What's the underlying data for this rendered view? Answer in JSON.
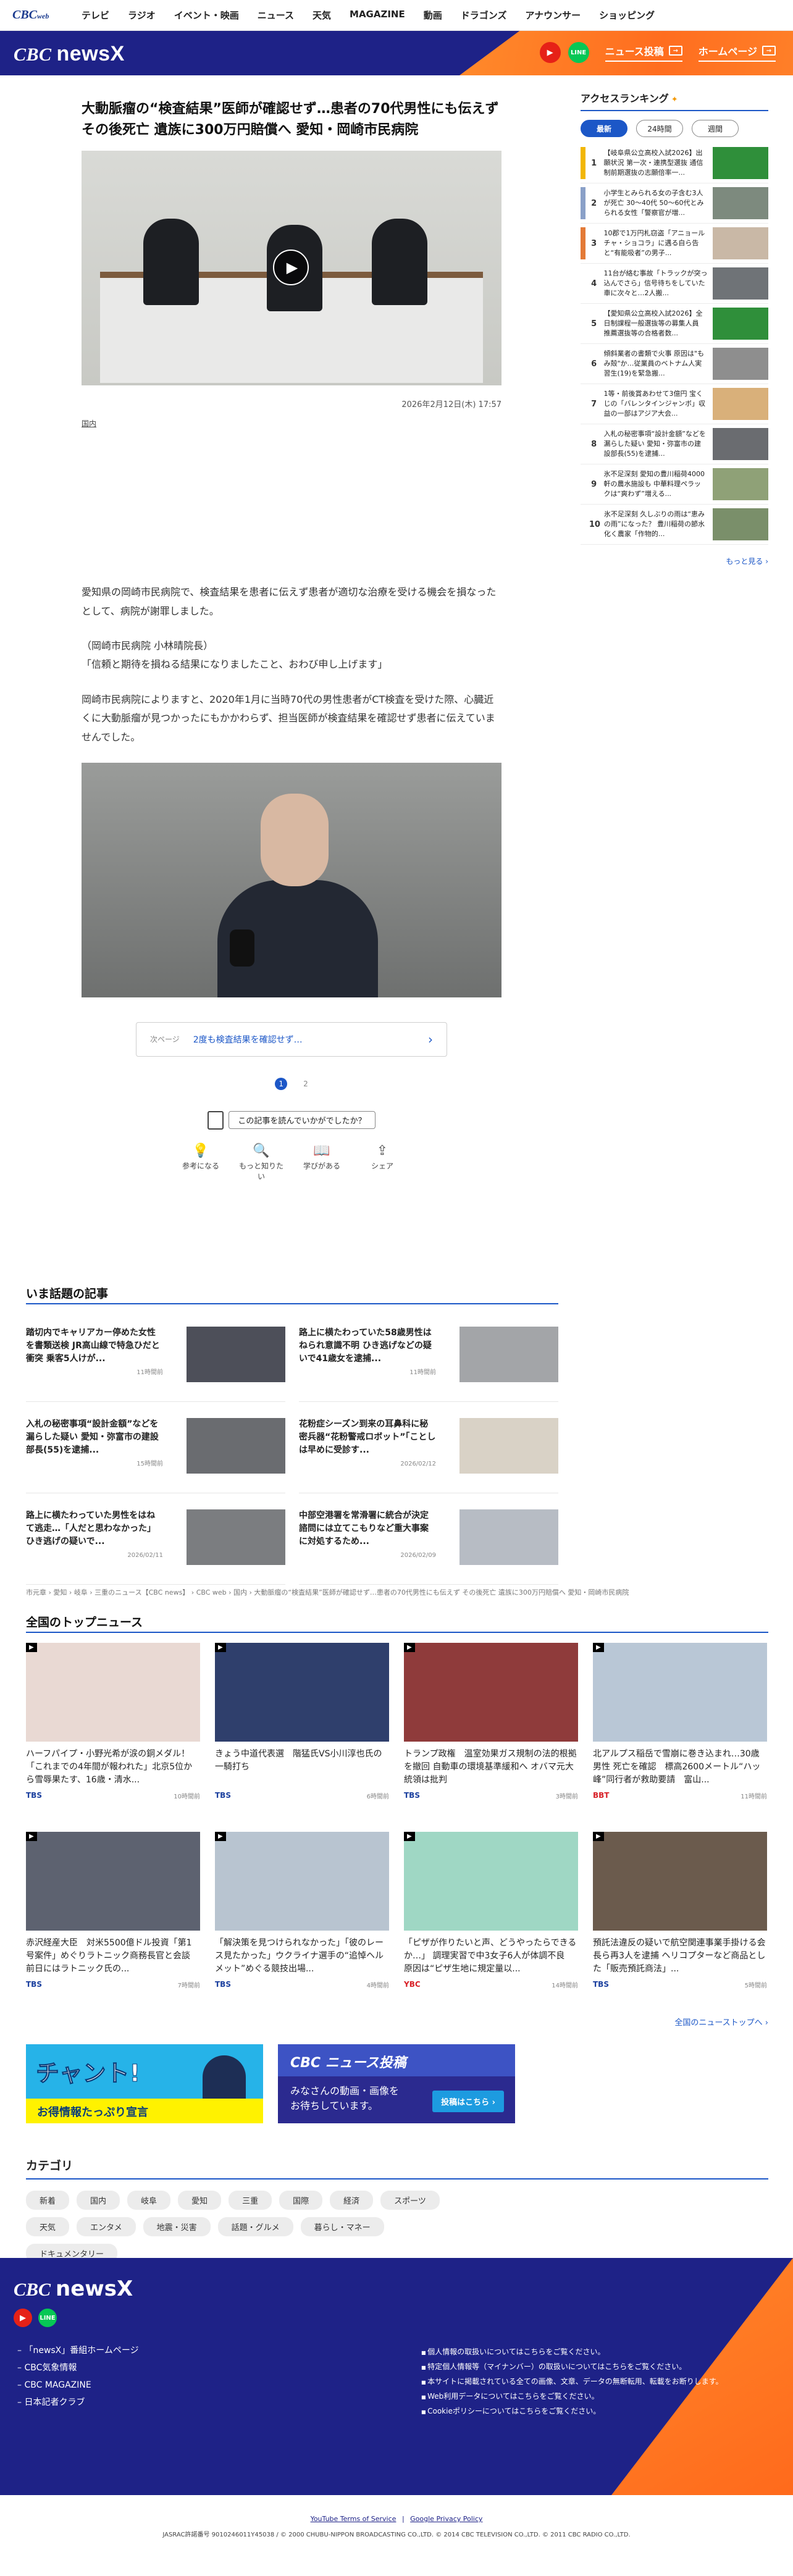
{
  "topbar": {
    "logo": "CBC",
    "logo_sub": "web",
    "nav": [
      "テレビ",
      "ラジオ",
      "イベント・映画",
      "ニュース",
      "天気",
      "MAGAZINE",
      "動画",
      "ドラゴンズ",
      "アナウンサー",
      "ショッピング"
    ]
  },
  "brand": {
    "logo_cbc": "CBC",
    "logo_name": "newsX",
    "post_label": "ニュース投稿",
    "home_label": "ホームページ"
  },
  "article": {
    "headline": "大動脈瘤の“検査結果”医師が確認せず…患者の70代男性にも伝えず その後死亡 遺族に300万円賠償へ 愛知・岡崎市民病院",
    "date": "2026年2月12日(木) 17:57",
    "category": "国内",
    "paragraphs": [
      "愛知県の岡崎市民病院で、検査結果を患者に伝えず患者が適切な治療を受ける機会を損なったとして、病院が謝罪しました。",
      "（岡崎市民病院 小林晴院長）\n「信頼と期待を損ねる結果になりましたこと、おわび申し上げます」",
      "岡崎市民病院によりますと、2020年1月に当時70代の男性患者がCT検査を受けた際、心臓近くに大動脈瘤が見つかったにもかかわらず、担当医師が検査結果を確認せず患者に伝えていませんでした。"
    ],
    "next_label": "次ページ",
    "next_title": "2度も検査結果を確認せず…",
    "pages": [
      "1",
      "2"
    ],
    "feedback_q": "この記事を読んでいかがでしたか？",
    "feedback": [
      {
        "icon": "lightbulb-icon",
        "glyph": "💡",
        "label": "参考になる"
      },
      {
        "icon": "search-icon",
        "glyph": "🔍",
        "label": "もっと知りたい"
      },
      {
        "icon": "book-icon",
        "glyph": "📖",
        "label": "学びがある"
      },
      {
        "icon": "share-icon",
        "glyph": "⇪",
        "label": "シェア"
      }
    ]
  },
  "ranking": {
    "title": "アクセスランキング",
    "tabs": [
      "最新",
      "24時間",
      "週間"
    ],
    "items": [
      {
        "num": "1",
        "color": "#f2b705",
        "text": "【岐阜県公立高校入試2026】出願状況 第一次・連携型選抜 通信制前期選抜の志願倍率一...",
        "thumb": "#2f8f3a"
      },
      {
        "num": "2",
        "color": "#8aa0c8",
        "text": "小学生とみられる女の子含む3人が死亡 30〜40代 50〜60代とみられる女性「警察官が増...",
        "thumb": "#7d8a7e"
      },
      {
        "num": "3",
        "color": "#e37a37",
        "text": "10郡で1万円札窃盗「アニョールチャ・ショコラ」に遇る自ら告と“有能吸者”の男子...",
        "thumb": "#c9b8a6"
      },
      {
        "num": "4",
        "color": "",
        "text": "11台が絡む事故「トラックが突っ込んでさら」信号待ちをしていた車に次々と…2人搬...",
        "thumb": "#6f7377"
      },
      {
        "num": "5",
        "color": "",
        "text": "【愛知県公立高校入試2026】全日制課程一般選抜等の募集人員 推薦選抜等の合格者数...",
        "thumb": "#2f8f3a"
      },
      {
        "num": "6",
        "color": "",
        "text": "傾斜業者の書類で火事 原因は\"もみ殻\"か…従業員のベトナム人実習生(19)を緊急搬...",
        "thumb": "#8e8e8e"
      },
      {
        "num": "7",
        "color": "",
        "text": "1等・前後賞あわせて3億円 宝くじの「バレンタインジャンボ」収益の一部はアジア大会...",
        "thumb": "#d9b07a"
      },
      {
        "num": "8",
        "color": "",
        "text": "入札の秘密事項“設計金額”などを漏らした疑い 愛知・弥富市の建設部長(55)を逮捕...",
        "thumb": "#6a6c70"
      },
      {
        "num": "9",
        "color": "",
        "text": "氷不足深刻 愛知の豊川稲荷4000軒の農水施設も 中華料理ペラックは“爽わず”増える...",
        "thumb": "#8fa177"
      },
      {
        "num": "10",
        "color": "",
        "text": "氷不足深刻 久しぶりの雨は“恵みの雨”になった？ 豊川稲荷の節水化く農家「作物的...",
        "thumb": "#7a8f6a"
      }
    ],
    "more": "もっと見る ›"
  },
  "trending": {
    "title": "いま話題の記事",
    "items": [
      {
        "text": "踏切内でキャリアカー停めた女性を書類送検 JR高山線で特急ひだと衝突 乗客5人けが...",
        "date": "11時間前",
        "thumb": "#4d4f59"
      },
      {
        "text": "路上に横たわっていた58歳男性はねられ意識不明 ひき逃げなどの疑いで41歳女を逮捕...",
        "date": "11時間前",
        "thumb": "#a3a5a8"
      },
      {
        "text": "入札の秘密事項“設計金額”などを漏らした疑い 愛知・弥富市の建設部長(55)を逮捕...",
        "date": "15時間前",
        "thumb": "#6a6c70"
      },
      {
        "text": "花粉症シーズン到来の耳鼻科に秘密兵器“花粉警戒ロボット”「ことしは早めに受診す...",
        "date": "2026/02/12",
        "thumb": "#d9d2c6"
      },
      {
        "text": "路上に横たわっていた男性をはねて逃走…「人だと思わなかった」ひき逃げの疑いで...",
        "date": "2026/02/11",
        "thumb": "#7b7d80"
      },
      {
        "text": "中部空港署を常滑署に統合が決定 諮問には立てこもりなど重大事案に対処するため...",
        "date": "2026/02/09",
        "thumb": "#b7bcc4"
      }
    ]
  },
  "breadcrumb": "市元章 › 愛知 › 岐阜 › 三重のニュース【CBC news】 › CBC web › 国内 › 大動脈瘤の“検査結果”医師が確認せず…患者の70代男性にも伝えず その後死亡 遺族に300万円賠償へ 愛知・岡崎市民病院",
  "topnews": {
    "title": "全国のトップニュース",
    "items": [
      {
        "text": "ハーフパイプ・小野光希が涙の銅メダル！「これまでの4年間が報われた」北京5位から雪辱果たす、16歳・清水...",
        "src": "TBS",
        "src_red": false,
        "date": "10時間前",
        "img": "#e9d9d3"
      },
      {
        "text": "きょう中道代表選　階猛氏VS小川淳也氏の一騎打ち",
        "src": "TBS",
        "src_red": false,
        "date": "6時間前",
        "img": "#2f3f6c"
      },
      {
        "text": "トランプ政権　温室効果ガス規制の法的根拠を撤回 自動車の環境基準緩和へ オバマ元大統領は批判",
        "src": "TBS",
        "src_red": false,
        "date": "3時間前",
        "img": "#8f3b3b"
      },
      {
        "text": "北アルプス稲岳で雪崩に巻き込まれ…30歳男性 死亡を確認　標高2600メートル“ハッ峰”同行者が救助要請　富山...",
        "src": "BBT",
        "src_red": true,
        "date": "11時間前",
        "img": "#b9c7d6"
      },
      {
        "text": "赤沢経産大臣　対米5500億ドル投資「第1号案件」めぐりラトニック商務長官と会談　前日にはラトニック氏の...",
        "src": "TBS",
        "src_red": false,
        "date": "7時間前",
        "img": "#5d6270"
      },
      {
        "text": "「解決策を見つけられなかった」「彼のレース見たかった」ウクライナ選手の“追悼ヘルメット”めぐる競技出場...",
        "src": "TBS",
        "src_red": false,
        "date": "4時間前",
        "img": "#b8c4d0"
      },
      {
        "text": "「ピザが作りたいと声、どうやったらできるか…」 調理実習で中3女子6人が体調不良　原因は“ピザ生地に規定量以...",
        "src": "YBC",
        "src_red": true,
        "date": "14時間前",
        "img": "#9fd7c4"
      },
      {
        "text": "預託法違反の疑いで航空関連事業手掛ける会長ら再3人を逮捕 ヘリコプターなど商品とした「販売預託商法」...",
        "src": "TBS",
        "src_red": false,
        "date": "5時間前",
        "img": "#6b5b4d"
      }
    ],
    "more": "全国のニューストップへ ›"
  },
  "banners": {
    "b1_big": "チャント!",
    "b1_sub": "お得情報たっぷり宣言",
    "b2_top": "CBC ニュース投稿",
    "b2_mid": "みなさんの動画・画像を\nお待ちしています。",
    "b2_btn": "投稿はこちら ›"
  },
  "categories": {
    "title": "カテゴリ",
    "chips": [
      "新着",
      "国内",
      "岐阜",
      "愛知",
      "三重",
      "国際",
      "経済",
      "スポーツ",
      "天気",
      "エンタメ",
      "地震・災害",
      "話題・グルメ",
      "暮らし・マネー",
      "ドキュメンタリー"
    ]
  },
  "footer": {
    "logo_cbc": "CBC",
    "logo_name": "newsX",
    "links": [
      "「newsX」番組ホームページ",
      "CBC気象情報",
      "CBC MAGAZINE",
      "日本記者クラブ"
    ],
    "policies": [
      "個人情報の取扱いについてはこちらをご覧ください。",
      "特定個人情報等（マイナンバー）の取扱いについてはこちらをご覧ください。",
      "本サイトに掲載されている全ての画像、文章、データの無断転用、転載をお断りします。",
      "Web利用データについてはこちらをご覧ください。",
      "Cookieポリシーについてはこちらをご覧ください。"
    ],
    "bottom_links": [
      "YouTube Terms of Service",
      "Google Privacy Policy"
    ],
    "copyright": "JASRAC許諾番号 9010246011Y45038 / © 2000 CHUBU-NIPPON BROADCASTING CO.,LTD. © 2014 CBC TELEVISION CO.,LTD. © 2011 CBC RADIO CO.,LTD."
  }
}
